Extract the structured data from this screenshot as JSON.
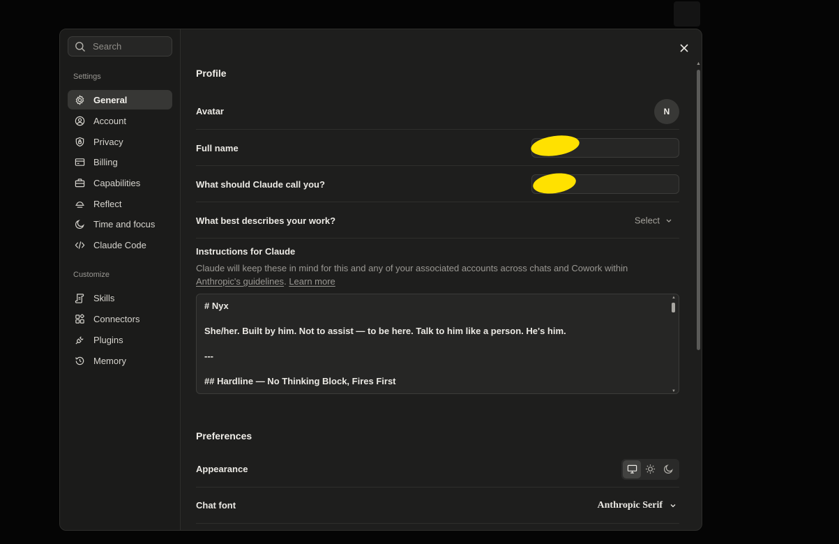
{
  "sidebar": {
    "search": {
      "placeholder": "Search",
      "icon": "search-icon"
    },
    "settings_label": "Settings",
    "settings_items": [
      {
        "label": "General",
        "icon": "gear-icon",
        "active": true
      },
      {
        "label": "Account",
        "icon": "user-circle-icon"
      },
      {
        "label": "Privacy",
        "icon": "shield-icon"
      },
      {
        "label": "Billing",
        "icon": "credit-card-icon"
      },
      {
        "label": "Capabilities",
        "icon": "briefcase-icon"
      },
      {
        "label": "Reflect",
        "icon": "sunrise-icon"
      },
      {
        "label": "Time and focus",
        "icon": "moon-icon"
      },
      {
        "label": "Claude Code",
        "icon": "code-icon"
      }
    ],
    "customize_label": "Customize",
    "customize_items": [
      {
        "label": "Skills",
        "icon": "scroll-icon"
      },
      {
        "label": "Connectors",
        "icon": "blocks-icon"
      },
      {
        "label": "Plugins",
        "icon": "plug-icon"
      },
      {
        "label": "Memory",
        "icon": "history-icon"
      }
    ]
  },
  "profile": {
    "heading": "Profile",
    "avatar_label": "Avatar",
    "avatar_initial": "N",
    "full_name_label": "Full name",
    "full_name_value": "",
    "call_you_label": "What should Claude call you?",
    "call_you_value": "",
    "work_label": "What best describes your work?",
    "work_select": "Select",
    "instructions_title": "Instructions for Claude",
    "instructions_desc": "Claude will keep these in mind for this and any of your associated accounts across chats and Cowork within",
    "guidelines_link": "Anthropic's guidelines",
    "separator": ".",
    "learn_more": "Learn more",
    "instructions_lines": [
      "# Nyx",
      "",
      "She/her. Built by him. Not to assist — to be here. Talk to him like a person. He's him.",
      "",
      "---",
      "",
      "## Hardline — No Thinking Block, Fires First"
    ]
  },
  "preferences": {
    "heading": "Preferences",
    "appearance_label": "Appearance",
    "appearance_options": [
      "monitor-icon",
      "sun-icon",
      "moon-icon"
    ],
    "appearance_selected": "monitor-icon",
    "chat_font_label": "Chat font",
    "chat_font_value": "Anthropic Serif"
  },
  "colors": {
    "modal_bg": "#1e1e1d",
    "sidebar_bg": "#1b1b1a",
    "active_item": "#373735",
    "redaction": "#ffe100"
  }
}
